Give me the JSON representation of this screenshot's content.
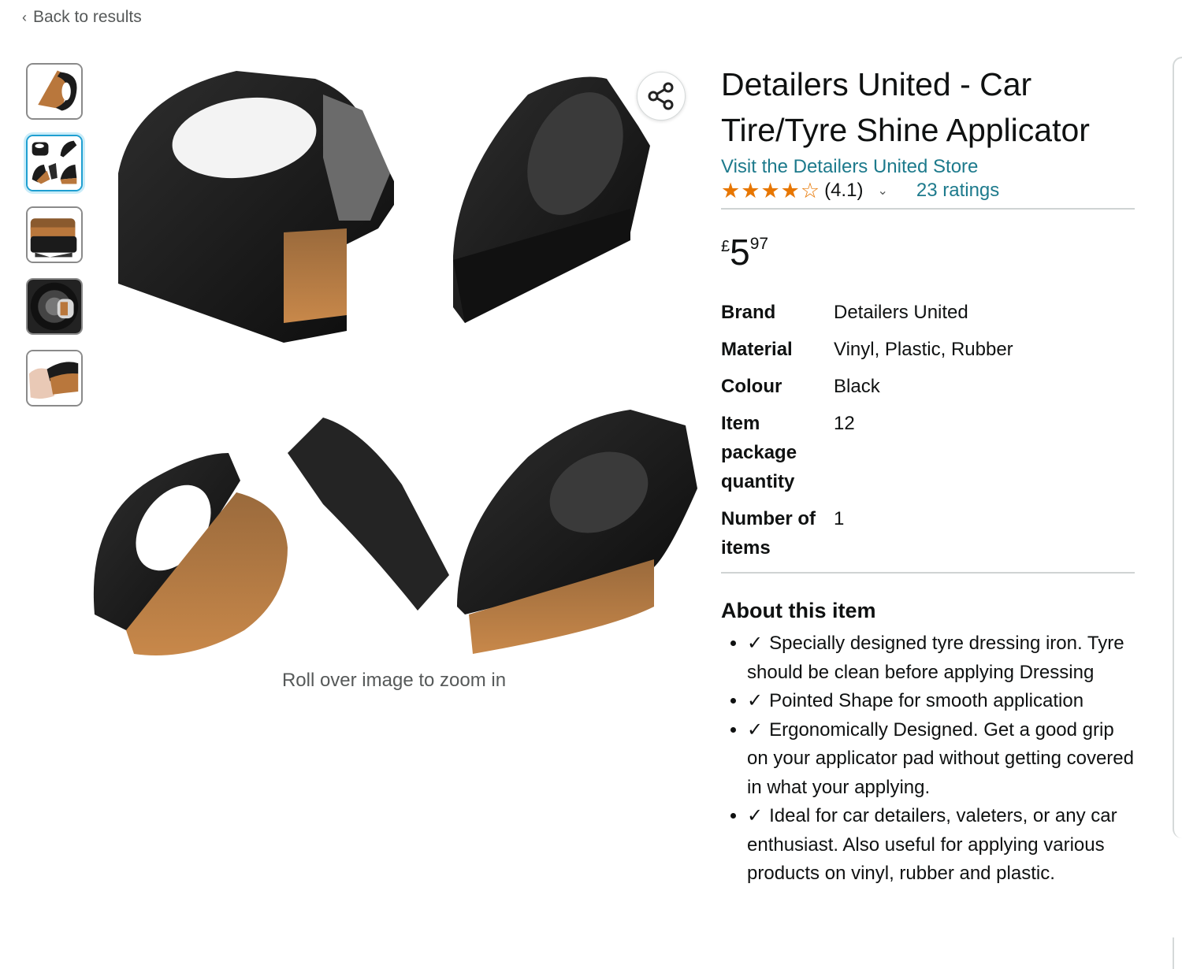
{
  "nav": {
    "back_label": "Back to results"
  },
  "gallery": {
    "thumbnails": [
      {
        "icon": "brush-side-view",
        "active": false
      },
      {
        "icon": "brush-multi-view",
        "active": true
      },
      {
        "icon": "brush-open-view",
        "active": false
      },
      {
        "icon": "brush-on-tyre",
        "active": false
      },
      {
        "icon": "brush-in-hand",
        "active": false
      }
    ],
    "zoom_hint": "Roll over image to zoom in",
    "share_icon": "share-icon"
  },
  "product": {
    "title": "Detailers United - Car Tire/Tyre Shine Applicator",
    "store_link": "Visit the Detailers United Store",
    "rating": {
      "value": 4.1,
      "value_label": "(4.1)",
      "ratings_label": "23 ratings",
      "star_color": "#e77600"
    },
    "price": {
      "currency": "£",
      "whole": "5",
      "fraction": "97"
    },
    "specs": [
      {
        "label": "Brand",
        "value": "Detailers United"
      },
      {
        "label": "Material",
        "value": "Vinyl, Plastic, Rubber"
      },
      {
        "label": "Colour",
        "value": "Black"
      },
      {
        "label": "Item package quantity",
        "value": "12"
      },
      {
        "label": "Number of items",
        "value": "1"
      }
    ],
    "about_heading": "About this item",
    "about_bullets": [
      "Specially designed tyre dressing iron. Tyre should be clean before applying Dressing",
      "Pointed Shape for smooth application",
      "Ergonomically Designed. Get a good grip on your applicator pad without getting covered in what your applying.",
      "Ideal for car detailers, valeters, or any car enthusiast. Also useful for applying various products on vinyl, rubber and plastic."
    ],
    "tick_glyph": "✓"
  },
  "colors": {
    "link": "#1d7a8c",
    "active_thumb": "#1f9fd1",
    "text": "#0f1111",
    "muted": "#565959"
  }
}
